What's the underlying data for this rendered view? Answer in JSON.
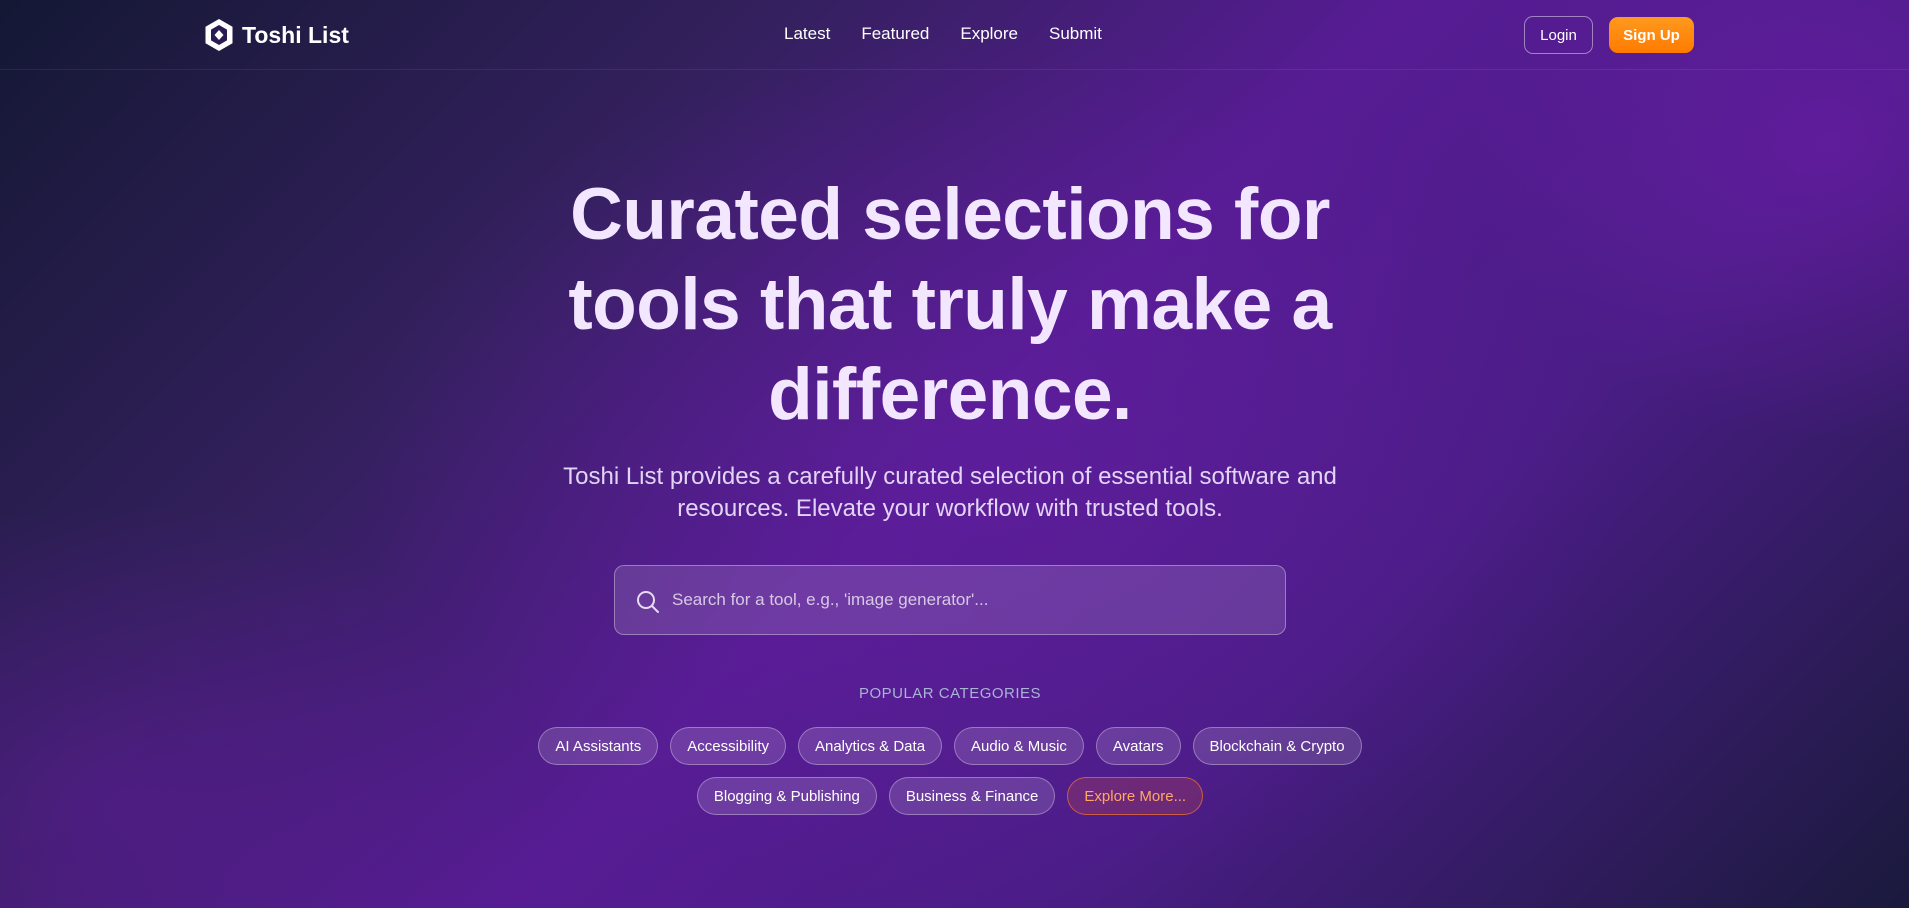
{
  "header": {
    "logo_text": "Toshi List",
    "nav": [
      "Latest",
      "Featured",
      "Explore",
      "Submit"
    ],
    "login_label": "Login",
    "signup_label": "Sign Up"
  },
  "hero": {
    "title": "Curated selections for tools that truly make a difference.",
    "subtitle": "Toshi List provides a carefully curated selection of essential software and resources. Elevate your workflow with trusted tools."
  },
  "search": {
    "placeholder": "Search for a tool, e.g., 'image generator'...",
    "value": ""
  },
  "categories": {
    "label": "POPULAR CATEGORIES",
    "items": [
      "AI Assistants",
      "Accessibility",
      "Analytics & Data",
      "Audio & Music",
      "Avatars",
      "Blockchain & Crypto",
      "Blogging & Publishing",
      "Business & Finance"
    ],
    "more_label": "Explore More..."
  },
  "colors": {
    "accent": "#ff8a0f",
    "background_dark": "#141834",
    "background_purple": "#571c94"
  },
  "icons": {
    "logo": "hexagon-logo-icon",
    "search": "search-icon"
  }
}
